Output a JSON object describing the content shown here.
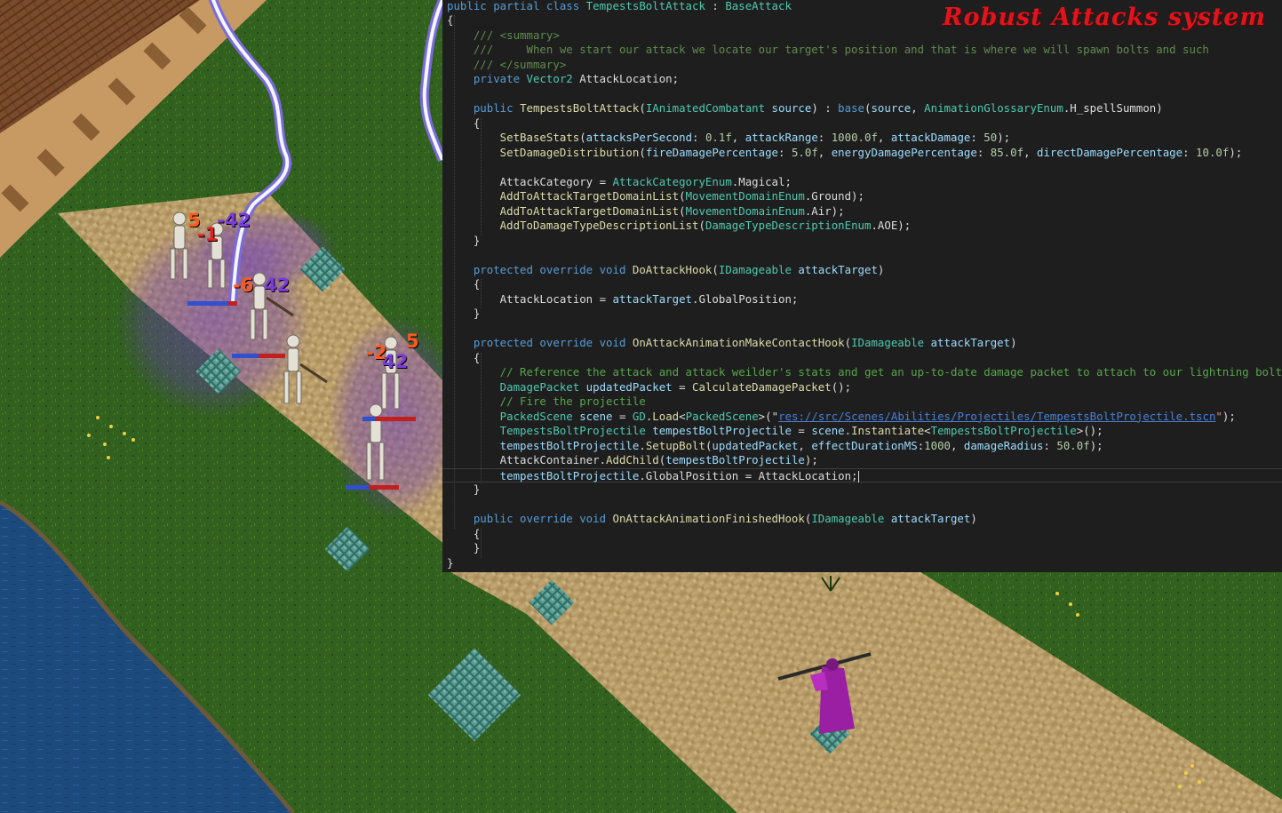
{
  "banner": {
    "title": "Robust Attacks system"
  },
  "damage_numbers": [
    {
      "text": "5",
      "color": "orange"
    },
    {
      "text": "-42",
      "color": "purple"
    },
    {
      "text": "-1",
      "color": "red"
    },
    {
      "text": "-6",
      "color": "orange"
    },
    {
      "text": "42",
      "color": "purple"
    },
    {
      "text": "-2",
      "color": "orange"
    },
    {
      "text": "5",
      "color": "orange"
    },
    {
      "text": "42",
      "color": "purple"
    }
  ],
  "code": {
    "current_line": 32,
    "lines": [
      [
        [
          "kw",
          "public partial class "
        ],
        [
          "type",
          "TempestsBoltAttack"
        ],
        [
          "plain",
          " : "
        ],
        [
          "type",
          "BaseAttack"
        ]
      ],
      [
        [
          "plain",
          "{"
        ]
      ],
      [
        [
          "doc",
          "    /// <summary>"
        ]
      ],
      [
        [
          "doc",
          "    ///     When we start our attack we locate our target's position and that is where we will spawn bolts and such"
        ]
      ],
      [
        [
          "doc",
          "    /// </summary>"
        ]
      ],
      [
        [
          "kw",
          "    private "
        ],
        [
          "type",
          "Vector2"
        ],
        [
          "plain",
          " AttackLocation;"
        ]
      ],
      [],
      [
        [
          "kw",
          "    public "
        ],
        [
          "fn",
          "TempestsBoltAttack"
        ],
        [
          "plain",
          "("
        ],
        [
          "type",
          "IAnimatedCombatant"
        ],
        [
          "var",
          " source"
        ],
        [
          "plain",
          ") : "
        ],
        [
          "kw",
          "base"
        ],
        [
          "plain",
          "("
        ],
        [
          "var",
          "source"
        ],
        [
          "plain",
          ", "
        ],
        [
          "type",
          "AnimationGlossaryEnum"
        ],
        [
          "plain",
          ".H_spellSummon)"
        ]
      ],
      [
        [
          "plain",
          "    {"
        ]
      ],
      [
        [
          "fn",
          "        SetBaseStats"
        ],
        [
          "plain",
          "("
        ],
        [
          "var",
          "attacksPerSecond"
        ],
        [
          "plain",
          ": "
        ],
        [
          "num",
          "0.1f"
        ],
        [
          "plain",
          ", "
        ],
        [
          "var",
          "attackRange"
        ],
        [
          "plain",
          ": "
        ],
        [
          "num",
          "1000.0f"
        ],
        [
          "plain",
          ", "
        ],
        [
          "var",
          "attackDamage"
        ],
        [
          "plain",
          ": "
        ],
        [
          "num",
          "50"
        ],
        [
          "plain",
          ");"
        ]
      ],
      [
        [
          "fn",
          "        SetDamageDistribution"
        ],
        [
          "plain",
          "("
        ],
        [
          "var",
          "fireDamagePercentage"
        ],
        [
          "plain",
          ": "
        ],
        [
          "num",
          "5.0f"
        ],
        [
          "plain",
          ", "
        ],
        [
          "var",
          "energyDamagePercentage"
        ],
        [
          "plain",
          ": "
        ],
        [
          "num",
          "85.0f"
        ],
        [
          "plain",
          ", "
        ],
        [
          "var",
          "directDamagePercentage"
        ],
        [
          "plain",
          ": "
        ],
        [
          "num",
          "10.0f"
        ],
        [
          "plain",
          ");"
        ]
      ],
      [],
      [
        [
          "plain",
          "        AttackCategory = "
        ],
        [
          "type",
          "AttackCategoryEnum"
        ],
        [
          "plain",
          ".Magical;"
        ]
      ],
      [
        [
          "fn",
          "        AddToAttackTargetDomainList"
        ],
        [
          "plain",
          "("
        ],
        [
          "type",
          "MovementDomainEnum"
        ],
        [
          "plain",
          ".Ground);"
        ]
      ],
      [
        [
          "fn",
          "        AddToAttackTargetDomainList"
        ],
        [
          "plain",
          "("
        ],
        [
          "type",
          "MovementDomainEnum"
        ],
        [
          "plain",
          ".Air);"
        ]
      ],
      [
        [
          "fn",
          "        AddToDamageTypeDescriptionList"
        ],
        [
          "plain",
          "("
        ],
        [
          "type",
          "DamageTypeDescriptionEnum"
        ],
        [
          "plain",
          ".AOE);"
        ]
      ],
      [
        [
          "plain",
          "    }"
        ]
      ],
      [],
      [
        [
          "kw",
          "    protected override void "
        ],
        [
          "fn",
          "DoAttackHook"
        ],
        [
          "plain",
          "("
        ],
        [
          "type",
          "IDamageable"
        ],
        [
          "var",
          " attackTarget"
        ],
        [
          "plain",
          ")"
        ]
      ],
      [
        [
          "plain",
          "    {"
        ]
      ],
      [
        [
          "plain",
          "        AttackLocation = "
        ],
        [
          "var",
          "attackTarget"
        ],
        [
          "plain",
          ".GlobalPosition;"
        ]
      ],
      [
        [
          "plain",
          "    }"
        ]
      ],
      [],
      [
        [
          "kw",
          "    protected override void "
        ],
        [
          "fn",
          "OnAttackAnimationMakeContactHook"
        ],
        [
          "plain",
          "("
        ],
        [
          "type",
          "IDamageable"
        ],
        [
          "var",
          " attackTarget"
        ],
        [
          "plain",
          ")"
        ]
      ],
      [
        [
          "plain",
          "    {"
        ]
      ],
      [
        [
          "com",
          "        // Reference the attack and attack weilder's stats and get an up-to-date damage packet to attach to our lightning bolt"
        ]
      ],
      [
        [
          "type",
          "        DamagePacket"
        ],
        [
          "var",
          " updatedPacket"
        ],
        [
          "plain",
          " = "
        ],
        [
          "fn",
          "CalculateDamagePacket"
        ],
        [
          "plain",
          "();"
        ]
      ],
      [
        [
          "com",
          "        // Fire the projectile"
        ]
      ],
      [
        [
          "type",
          "        PackedScene"
        ],
        [
          "var",
          " scene"
        ],
        [
          "plain",
          " = "
        ],
        [
          "type",
          "GD"
        ],
        [
          "plain",
          "."
        ],
        [
          "fn",
          "Load"
        ],
        [
          "plain",
          "<"
        ],
        [
          "type",
          "PackedScene"
        ],
        [
          "plain",
          ">(\""
        ],
        [
          "link",
          "res://src/Scenes/Abilities/Projectiles/TempestsBoltProjectile.tscn"
        ],
        [
          "str",
          "\""
        ],
        [
          "plain",
          ");"
        ]
      ],
      [
        [
          "type",
          "        TempestsBoltProjectile"
        ],
        [
          "var",
          " tempestBoltProjectile"
        ],
        [
          "plain",
          " = "
        ],
        [
          "var",
          "scene"
        ],
        [
          "plain",
          "."
        ],
        [
          "fn",
          "Instantiate"
        ],
        [
          "plain",
          "<"
        ],
        [
          "type",
          "TempestsBoltProjectile"
        ],
        [
          "plain",
          ">();"
        ]
      ],
      [
        [
          "var",
          "        tempestBoltProjectile"
        ],
        [
          "plain",
          "."
        ],
        [
          "fn",
          "SetupBolt"
        ],
        [
          "plain",
          "("
        ],
        [
          "var",
          "updatedPacket"
        ],
        [
          "plain",
          ", "
        ],
        [
          "var",
          "effectDurationMS"
        ],
        [
          "plain",
          ":"
        ],
        [
          "num",
          "1000"
        ],
        [
          "plain",
          ", "
        ],
        [
          "var",
          "damageRadius"
        ],
        [
          "plain",
          ": "
        ],
        [
          "num",
          "50.0f"
        ],
        [
          "plain",
          ");"
        ]
      ],
      [
        [
          "plain",
          "        AttackContainer."
        ],
        [
          "fn",
          "AddChild"
        ],
        [
          "plain",
          "("
        ],
        [
          "var",
          "tempestBoltProjectile"
        ],
        [
          "plain",
          ");"
        ]
      ],
      [
        [
          "var",
          "        tempestBoltProjectile"
        ],
        [
          "plain",
          ".GlobalPosition = AttackLocation;"
        ]
      ],
      [
        [
          "plain",
          "    }"
        ]
      ],
      [],
      [
        [
          "kw",
          "    public override void "
        ],
        [
          "fn",
          "OnAttackAnimationFinishedHook"
        ],
        [
          "plain",
          "("
        ],
        [
          "type",
          "IDamageable"
        ],
        [
          "var",
          " attackTarget"
        ],
        [
          "plain",
          ")"
        ]
      ],
      [
        [
          "plain",
          "    {"
        ]
      ],
      [
        [
          "plain",
          "    }"
        ]
      ],
      [
        [
          "plain",
          "}"
        ]
      ]
    ]
  }
}
